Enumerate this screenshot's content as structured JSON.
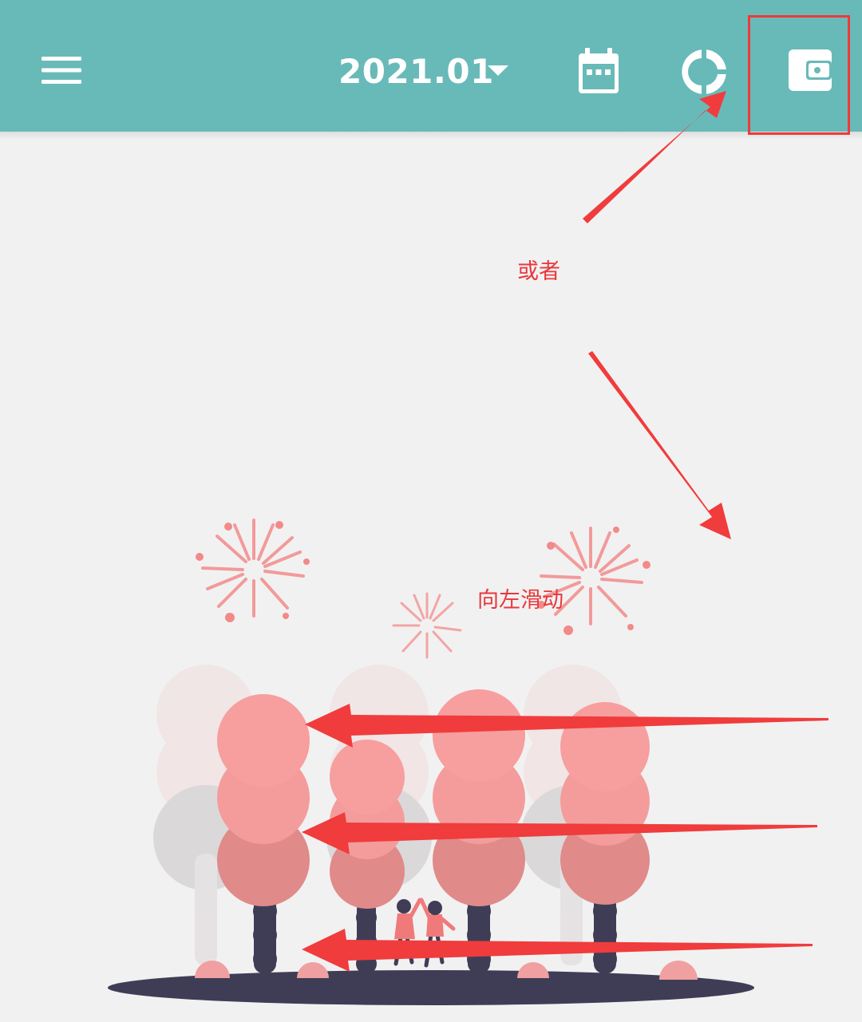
{
  "header": {
    "month": "2021.01",
    "menu_icon": "hamburger-menu-icon",
    "dropdown_icon": "caret-down-icon",
    "calendar_icon": "calendar-icon",
    "chart_icon": "donut-chart-icon",
    "wallet_icon": "wallet-icon",
    "background_color": "#68bab8"
  },
  "annotations": {
    "or_text": "或者",
    "swipe_text": "向左滑动",
    "color": "#ef3a3a"
  },
  "illustration": {
    "name": "empty-state-celebration"
  }
}
